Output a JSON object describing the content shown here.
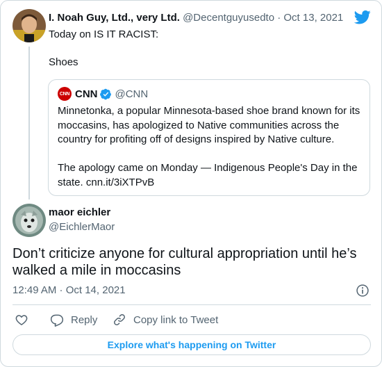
{
  "parent_tweet": {
    "display_name": "I. Noah Guy, Ltd., very Ltd.",
    "handle_date": "@Decentguyusedto · Oct 13, 2021",
    "text": "Today on IS IT RACIST:\n\nShoes"
  },
  "quoted_tweet": {
    "logo_text": "CNN",
    "display_name": "CNN",
    "handle": "@CNN",
    "text": "Minnetonka, a popular Minnesota-based shoe brand known for its moccasins, has apologized to Native communities across the country for profiting off of designs inspired by Native culture.\n\nThe apology came on Monday — Indigenous People's Day in the state. cnn.it/3iXTPvB"
  },
  "main_tweet": {
    "display_name": "maor eichler",
    "handle": "@EichlerMaor",
    "text": "Don’t criticize anyone for cultural appropriation until he’s walked a mile in moccasins",
    "timestamp": "12:49 AM · Oct 14, 2021"
  },
  "actions": {
    "reply_label": "Reply",
    "copy_label": "Copy link to Tweet"
  },
  "explore_label": "Explore what's happening on Twitter",
  "colors": {
    "accent": "#1d9bf0",
    "muted": "#536471",
    "border": "#cfd9de",
    "cnn_red": "#cc0000"
  },
  "icons": [
    "twitter-bird-icon",
    "verified-badge-icon",
    "info-icon",
    "heart-icon",
    "reply-icon",
    "link-icon"
  ]
}
